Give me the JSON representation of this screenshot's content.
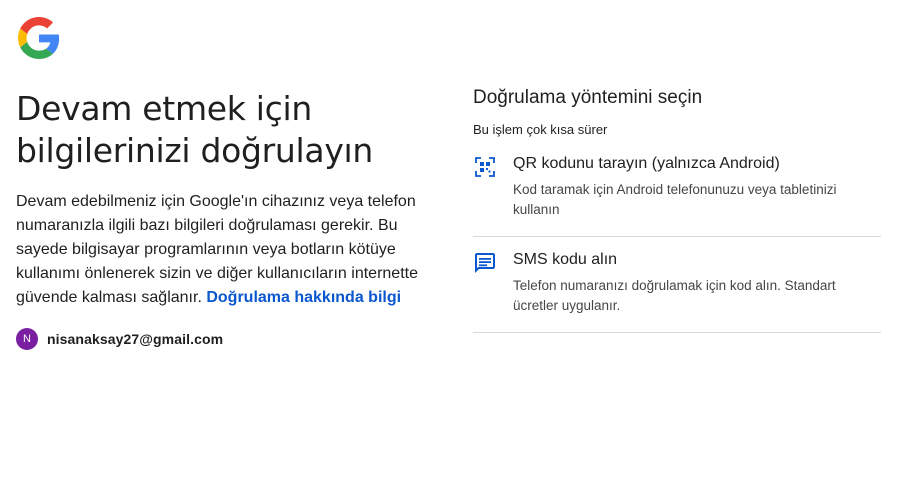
{
  "brand": {
    "logo_icon": "google-g-logo-icon"
  },
  "left": {
    "headline_line1": "Devam etmek için",
    "headline_line2": "bilgilerinizi doğrulayın",
    "description": "Devam edebilmeniz için Google'ın cihazınız veya telefon numaranızla ilgili bazı bilgileri doğrulaması gerekir. Bu sayede bilgisayar programlarının veya botların kötüye kullanımı önlenerek sizin ve diğer kullanıcıların internette güvende kalması sağlanır.",
    "learn_more_link": "Doğrulama hakkında bilgi",
    "account": {
      "avatar_letter": "N",
      "email": "nisanaksay27@gmail.com",
      "avatar_color": "#7b1fa2"
    }
  },
  "right": {
    "title": "Doğrulama yöntemini seçin",
    "subtitle": "Bu işlem çok kısa sürer",
    "options": [
      {
        "icon": "qr-code-icon",
        "title": "QR kodunu tarayın (yalnızca Android)",
        "description": "Kod taramak için Android telefonunuzu veya tabletinizi kullanın"
      },
      {
        "icon": "sms-message-icon",
        "title": "SMS kodu alın",
        "description": "Telefon numaranızı doğrulamak için kod alın. Standart ücretler uygulanır."
      }
    ]
  },
  "colors": {
    "link": "#0b57d0",
    "icon_blue": "#0b57d0",
    "divider": "#d9d9d9"
  }
}
